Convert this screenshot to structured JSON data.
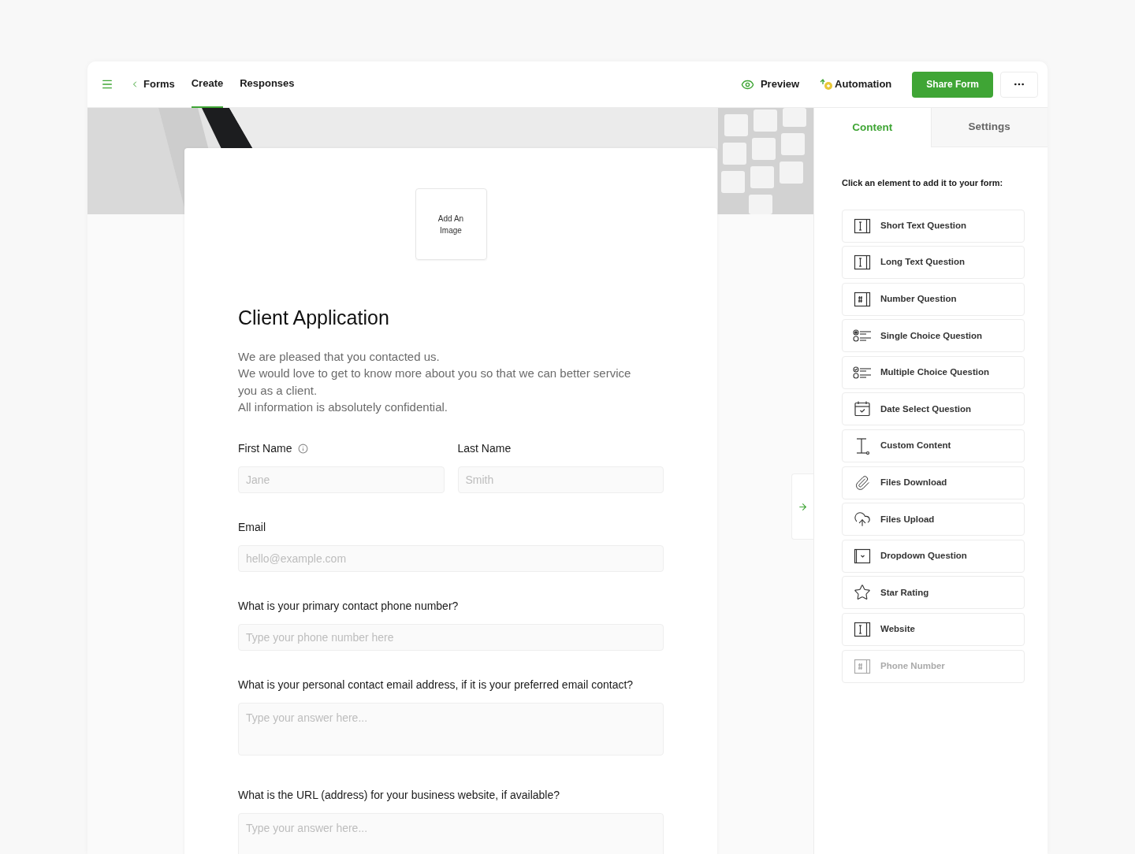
{
  "header": {
    "back_link": "Forms",
    "tabs": [
      {
        "label": "Create",
        "selected": true
      },
      {
        "label": "Responses",
        "selected": false
      }
    ],
    "preview": "Preview",
    "automation": "Automation",
    "share_button": "Share Form"
  },
  "form": {
    "add_image": "Add An Image",
    "title": "Client Application",
    "description": [
      "We are pleased that you contacted us.",
      "We would love to get to know more about you so that we can better service you as a client.",
      "All information is absolutely confidential."
    ],
    "fields": [
      {
        "kind": "half",
        "label": "First Name",
        "info": true,
        "placeholder": "Jane"
      },
      {
        "kind": "half",
        "label": "Last Name",
        "info": false,
        "placeholder": "Smith"
      },
      {
        "kind": "short",
        "label": "Email",
        "info": false,
        "placeholder": "hello@example.com"
      },
      {
        "kind": "short",
        "label": "What is your primary contact phone number?",
        "info": false,
        "placeholder": "Type your phone number here"
      },
      {
        "kind": "long",
        "label": "What is your personal contact email address, if it is your preferred email contact?",
        "info": false,
        "placeholder": "Type your answer here..."
      },
      {
        "kind": "long",
        "label": "What is the URL (address) for your business website, if available?",
        "info": false,
        "placeholder": "Type your answer here..."
      }
    ]
  },
  "panel": {
    "tabs": [
      {
        "label": "Content",
        "selected": true
      },
      {
        "label": "Settings",
        "selected": false
      }
    ],
    "hint": "Click an element to add it to your form:",
    "elements": [
      {
        "kind": "text",
        "label": "Short Text Question",
        "disabled": false
      },
      {
        "kind": "text",
        "label": "Long Text Question",
        "disabled": false
      },
      {
        "kind": "number",
        "label": "Number Question",
        "disabled": false
      },
      {
        "kind": "single",
        "label": "Single Choice Question",
        "disabled": false
      },
      {
        "kind": "multiple",
        "label": "Multiple Choice Question",
        "disabled": false
      },
      {
        "kind": "date",
        "label": "Date Select Question",
        "disabled": false
      },
      {
        "kind": "custom",
        "label": "Custom Content",
        "disabled": false
      },
      {
        "kind": "attach",
        "label": "Files Download",
        "disabled": false
      },
      {
        "kind": "upload",
        "label": "Files Upload",
        "disabled": false
      },
      {
        "kind": "dropdown",
        "label": "Dropdown Question",
        "disabled": false
      },
      {
        "kind": "star",
        "label": "Star Rating",
        "disabled": false
      },
      {
        "kind": "text",
        "label": "Website",
        "disabled": false
      },
      {
        "kind": "number",
        "label": "Phone Number",
        "disabled": true
      }
    ]
  }
}
